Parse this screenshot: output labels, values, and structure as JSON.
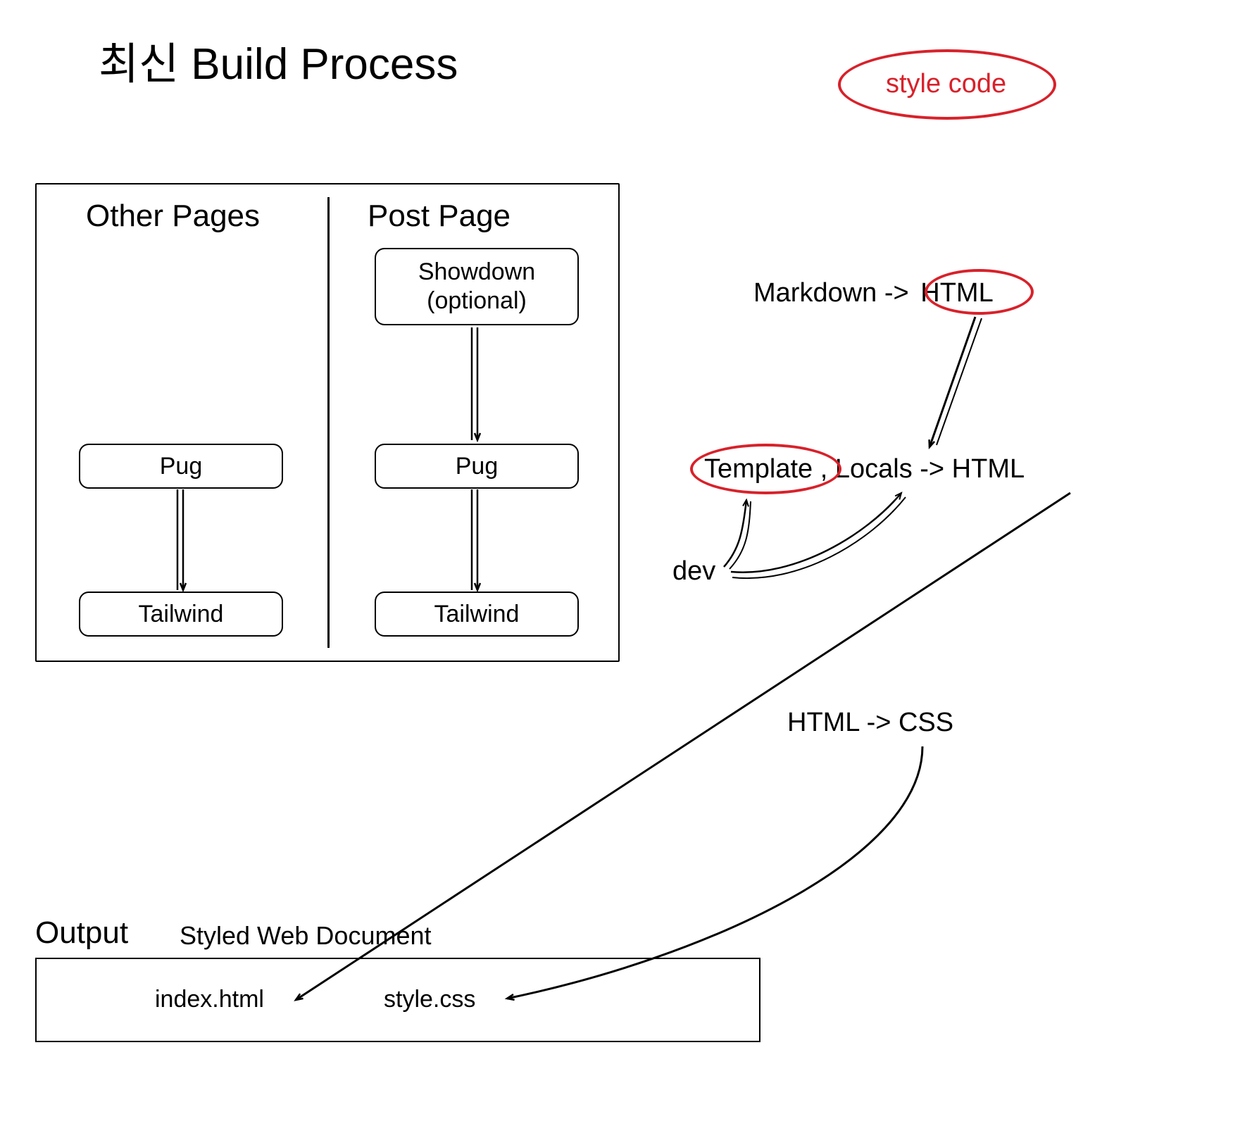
{
  "title": "최신 Build Process",
  "annotation": {
    "styleCode": "style code"
  },
  "bigBox": {
    "leftHeader": "Other Pages",
    "rightHeader": "Post Page",
    "leftPipeline": {
      "step1": "Pug",
      "step2": "Tailwind"
    },
    "rightPipeline": {
      "step0line1": "Showdown",
      "step0line2": "(optional)",
      "step1": "Pug",
      "step2": "Tailwind"
    }
  },
  "side": {
    "markdownArrow": "Markdown ->",
    "html": "HTML",
    "template": "Template",
    "localsArrowHtml": ", Locals -> HTML",
    "dev": "dev",
    "htmlToCss": "HTML -> CSS"
  },
  "output": {
    "title": "Output",
    "subtitle": "Styled Web Document",
    "file1": "index.html",
    "file2": "style.css"
  }
}
